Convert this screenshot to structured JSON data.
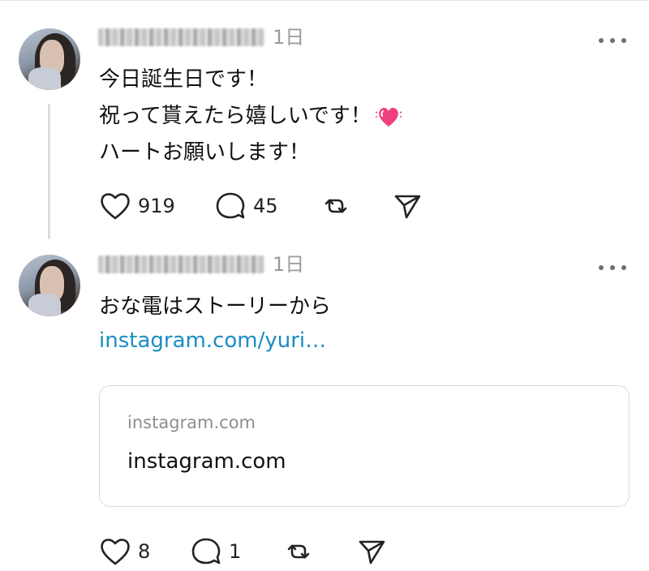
{
  "posts": [
    {
      "time": "1日",
      "lines": [
        "今日誕生日です！",
        "祝って貰えたら嬉しいです！",
        "ハートお願いします！"
      ],
      "emoji": "heart-emoji",
      "likes": "919",
      "replies": "45"
    },
    {
      "time": "1日",
      "lines": [
        "おな電はストーリーから"
      ],
      "link_text": "instagram.com/yuri…",
      "card": {
        "domain": "instagram.com",
        "title": "instagram.com"
      },
      "likes": "8",
      "replies": "1"
    }
  ],
  "colors": {
    "link": "#1b8dc4",
    "muted": "#9a9a9a",
    "emoji_pink": "#f0407f"
  }
}
